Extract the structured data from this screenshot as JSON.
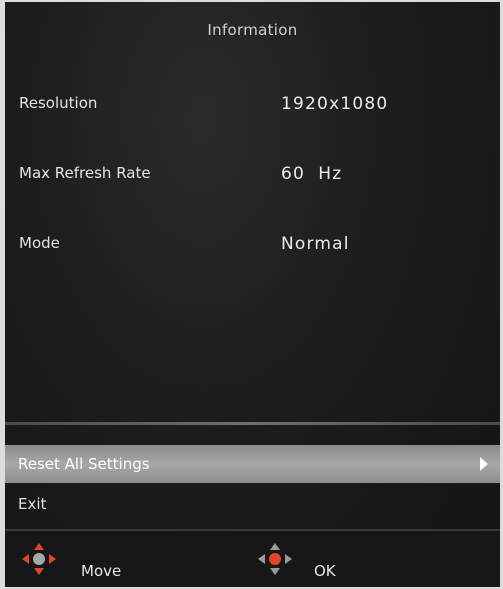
{
  "title": "Information",
  "rows": [
    {
      "label": "Resolution",
      "value": "1920x1080"
    },
    {
      "label": "Max Refresh Rate",
      "value": "60  Hz"
    },
    {
      "label": "Mode",
      "value": "Normal"
    }
  ],
  "menu": {
    "reset_label": "Reset All Settings",
    "exit_label": "Exit"
  },
  "footer": {
    "move_label": "Move",
    "ok_label": "OK"
  },
  "colors": {
    "accent": "#e2452a",
    "selected_bg": "#9a9a9a",
    "panel_bg": "#1c1c1c"
  },
  "icons": {
    "submenu": "chevron-right-icon",
    "move": "dpad-move-icon",
    "ok": "dpad-ok-icon"
  }
}
